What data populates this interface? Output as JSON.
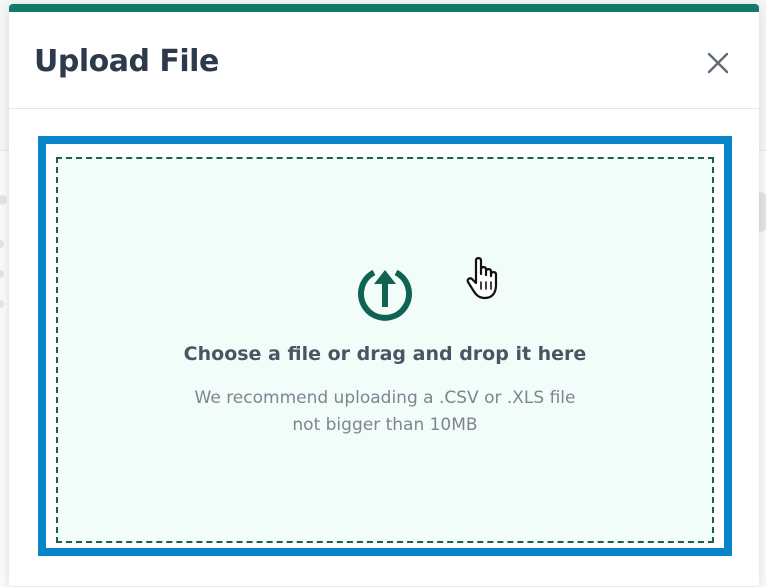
{
  "modal": {
    "title": "Upload File",
    "accent_color": "#127a68"
  },
  "icons": {
    "close": "close-icon",
    "upload": "upload-circle-arrow-icon",
    "cursor": "hand-pointer-cursor-icon"
  },
  "dropzone": {
    "heading": "Choose a file or drag and drop it here",
    "hint_line1": "We recommend uploading a .CSV or .XLS file",
    "hint_line2": "not bigger than 10MB",
    "focus_color": "#0a85c9",
    "background_color": "#f2fcf8"
  }
}
